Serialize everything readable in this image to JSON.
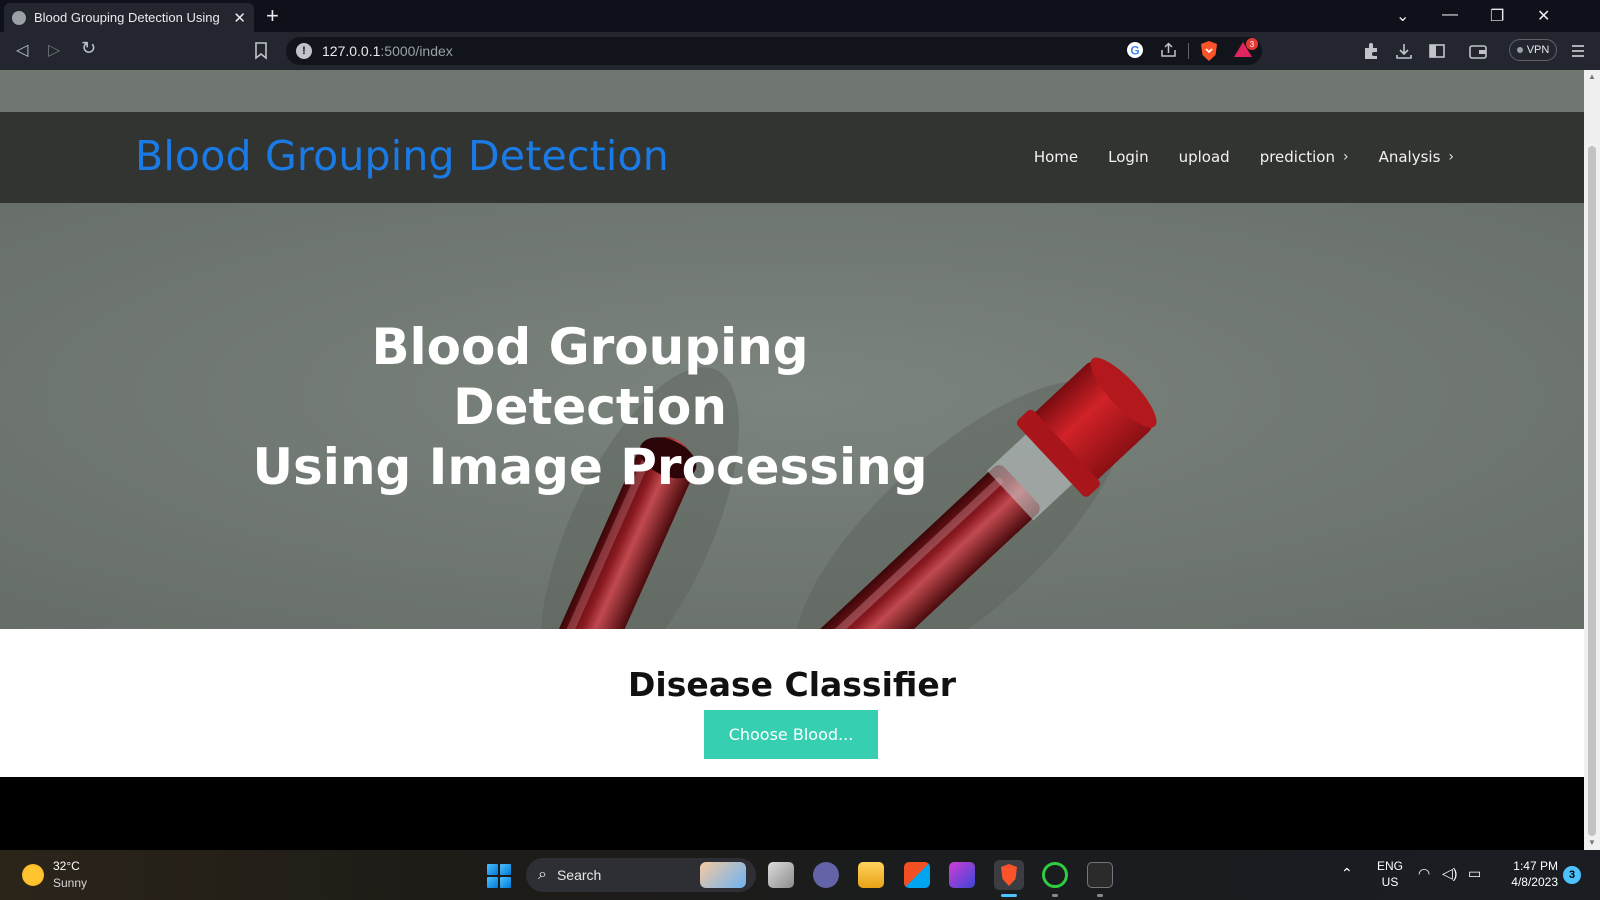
{
  "browser": {
    "tab_title": "Blood Grouping Detection Using Image Processing",
    "tab_close": "✕",
    "new_tab": "+",
    "url_host": "127.0.0.1",
    "url_path": ":5000/index",
    "vpn_label": "VPN",
    "window_controls": {
      "minimize": "—",
      "maximize": "❐",
      "close": "✕",
      "tab_list": "⌄"
    },
    "nav": {
      "back": "◁",
      "forward": "▷",
      "reload": "↻"
    },
    "notification_badge": "3"
  },
  "site": {
    "logo": "Blood Grouping Detection",
    "nav": [
      {
        "label": "Home"
      },
      {
        "label": "Login"
      },
      {
        "label": "upload"
      },
      {
        "label": "prediction",
        "chevron": "›"
      },
      {
        "label": "Analysis",
        "chevron": "›"
      }
    ]
  },
  "hero": {
    "title_line1": "Blood Grouping Detection",
    "title_line2": "Using Image Processing"
  },
  "content": {
    "title": "Disease Classifier",
    "button_label": "Choose Blood..."
  },
  "taskbar": {
    "weather_temp": "32°C",
    "weather_condition": "Sunny",
    "search_label": "Search",
    "lang_line1": "ENG",
    "lang_line2": "US",
    "time": "1:47 PM",
    "date": "4/8/2023",
    "notifications": "3"
  },
  "colors": {
    "logo": "#1a7ae6",
    "header_bg": "#323431",
    "hero_bg": "#727a74",
    "button": "#37cfb1",
    "tube_cap": "#b3181c"
  }
}
